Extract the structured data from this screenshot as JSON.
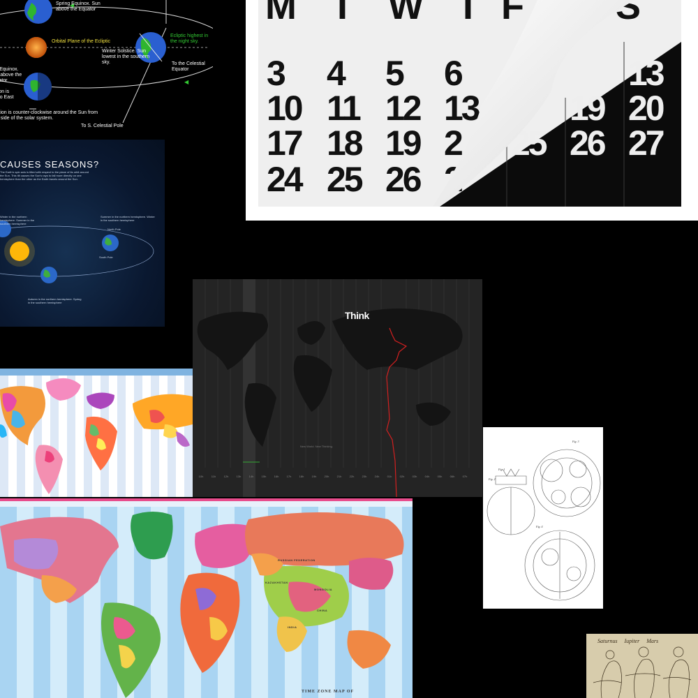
{
  "ecliptic": {
    "spring": "Spring Equinox. Sun above the Equator",
    "orbital_plane": "Orbital Plane of the Ecliptic",
    "winter": "Winter Solstice. Sun lowest in the southern sky.",
    "fall": "Fall Equinox. Sun above the Equator",
    "ecliptic_highest": "Ecliptic highest in the night sky.",
    "to_celestial": "To the Celestial Equator",
    "rotation": "Rotation is West to East",
    "motion": "Earth motion is counter-clockwise around the Sun from the North side of the solar system.",
    "south_pole": "To S. Celestial Pole"
  },
  "calendar": {
    "weekdays": [
      "M",
      "T",
      "W",
      "T",
      "F",
      "S"
    ],
    "rows": [
      [
        "3",
        "4",
        "5",
        "6"
      ],
      [
        "10",
        "11",
        "12",
        "13"
      ],
      [
        "17",
        "18",
        "19",
        "2"
      ],
      [
        "24",
        "25",
        "26",
        "2"
      ]
    ],
    "right_rows": [
      [
        "13"
      ],
      [
        "19",
        "20"
      ],
      [
        "25",
        "26",
        "27"
      ]
    ]
  },
  "seasons": {
    "title": "CAUSES SEASONS?",
    "intro": "The Earth's spin axis is tilted with respect to the plane of its orbit around the Sun. This tilt causes the Sun's rays to fall more directly on one hemisphere than the other as the Earth travels around the Sun.",
    "winter_north": "Winter in the northern hemisphere. Summer in the southern hemisphere",
    "summer_north": "Summer in the northern hemisphere. Winter in the southern hemisphere",
    "autumn_north": "Autumn in the northern hemisphere. Spring in the southern hemisphere",
    "north_pole": "North Pole",
    "south_pole": "South Pole"
  },
  "think": {
    "logo": "Think",
    "tagline": "New World. New Thinking.",
    "zones": [
      "10h",
      "11h",
      "12h",
      "13h",
      "14h",
      "15h",
      "16h",
      "17h",
      "18h",
      "19h",
      "20h",
      "21h",
      "22h",
      "23h",
      "24h",
      "01h",
      "02h",
      "03h",
      "04h",
      "05h",
      "06h",
      "07h"
    ]
  },
  "map2": {
    "title": "TIME ZONE MAP OF",
    "labels": [
      "RUSSIAN FEDERATION",
      "KAZAKHSTAN",
      "MONGOLIA",
      "CHINA",
      "INDIA"
    ]
  },
  "clockwork": {
    "figs": [
      "Fig. 1",
      "Fig. 2",
      "Fig. 3",
      "Fig. 4"
    ]
  },
  "engraving": {
    "caption": "Saturnus  Iupiter  Mars"
  },
  "colors": {
    "background": "#000000",
    "think_dateline": "#d42020",
    "ecliptic_green": "#33cc33",
    "ecliptic_yellow": "#f0e040"
  }
}
